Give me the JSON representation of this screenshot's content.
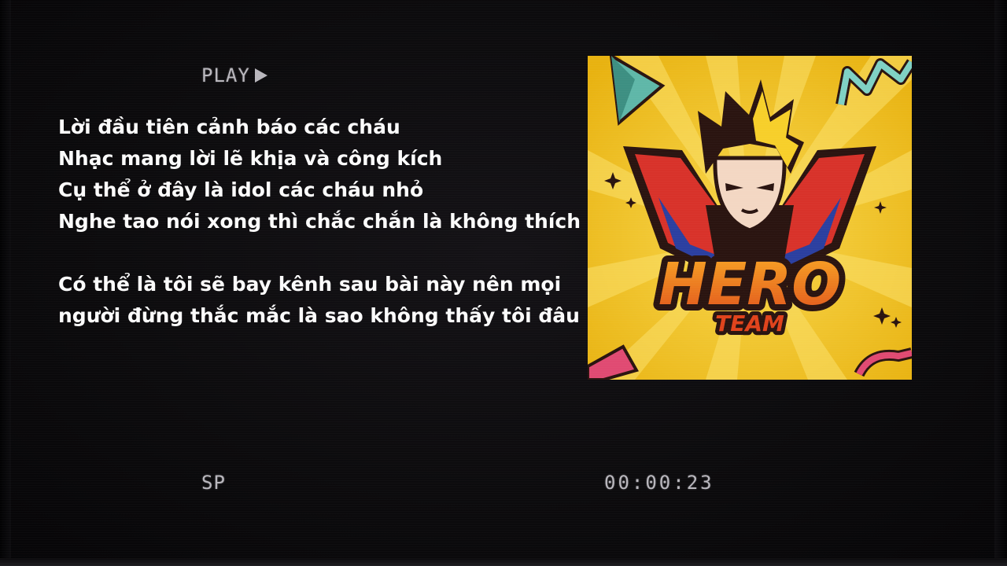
{
  "osd": {
    "play_label": "PLAY",
    "mode_label": "SP",
    "timecode": "00:00:23"
  },
  "lyrics": {
    "stanza1": [
      "Lời đầu tiên cảnh báo các cháu",
      "Nhạc mang lời lẽ khịa và công kích",
      "Cụ thể ở đây là idol các cháu nhỏ",
      "Nghe tao nói xong thì chắc chắn là không thích"
    ],
    "stanza2": [
      "Có thể là tôi sẽ bay kênh sau bài này nên mọi",
      "người đừng thắc mắc là sao không thấy tôi đâu"
    ]
  },
  "cover_art": {
    "logo_text_main": "HERO",
    "logo_text_sub": "TEAM",
    "colors": {
      "background": "#f2c21a",
      "ray": "#f7d34a",
      "cape_red": "#d8322a",
      "logo_orange": "#f08a1c",
      "outline": "#2a1410",
      "hair_yellow": "#f7cf2a",
      "accent_teal": "#5fb7a8",
      "accent_pink": "#e04a72"
    }
  },
  "icons": {
    "play": "play-triangle-icon"
  }
}
